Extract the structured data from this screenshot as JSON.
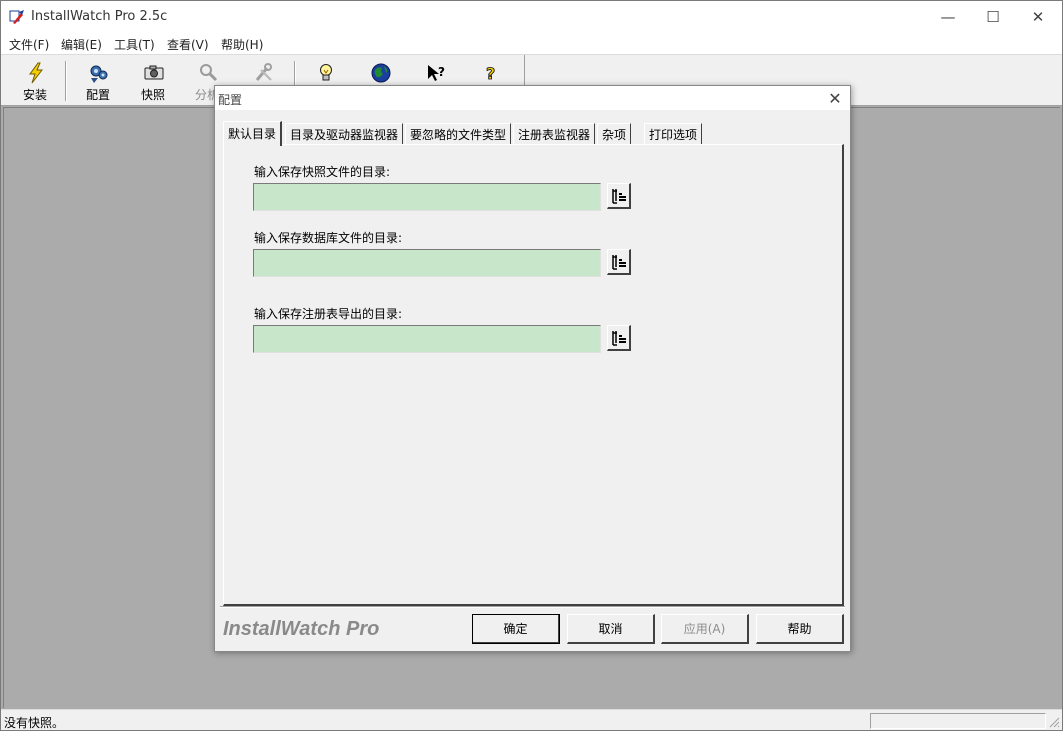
{
  "window": {
    "title": "InstallWatch Pro 2.5c",
    "controls": {
      "minimize": "—",
      "maximize": "☐",
      "close": "✕"
    }
  },
  "menu": [
    "文件(F)",
    "编辑(E)",
    "工具(T)",
    "查看(V)",
    "帮助(H)"
  ],
  "toolbar": {
    "install_label": "安装",
    "config_label": "配置",
    "snapshot_label": "快照",
    "analyze_label": "分析",
    "about_tip_icon": "lightbulb-icon",
    "web_icon": "globe-icon",
    "context_help_icon": "context-help-icon",
    "help_icon": "question-icon"
  },
  "status": {
    "text": "没有快照。"
  },
  "dialog": {
    "title": "配置",
    "tabs": [
      "默认目录",
      "目录及驱动器监视器",
      "要忽略的文件类型",
      "注册表监视器",
      "杂项",
      "打印选项"
    ],
    "active_tab": 0,
    "fields": {
      "snapshot_label": "输入保存快照文件的目录:",
      "snapshot_value": "",
      "database_label": "输入保存数据库文件的目录:",
      "database_value": "",
      "registry_label": "输入保存注册表导出的目录:",
      "registry_value": ""
    },
    "brand": "InstallWatch Pro",
    "buttons": {
      "ok": "确定",
      "cancel": "取消",
      "apply": "应用(A)",
      "help": "帮助"
    }
  },
  "colors": {
    "field_bg": "#c8e6c9",
    "workspace": "#ababab",
    "face": "#f0f0f0"
  }
}
